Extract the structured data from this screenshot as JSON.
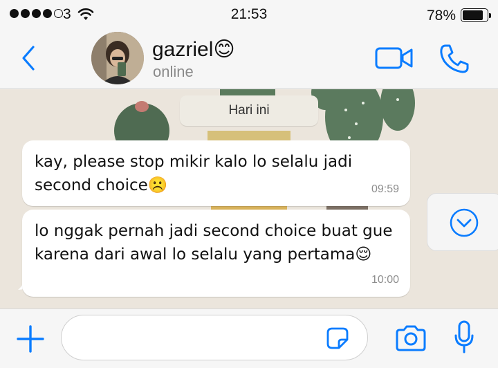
{
  "status_bar": {
    "carrier": "3",
    "time": "21:53",
    "battery_percent": "78%",
    "battery_level": 0.78,
    "signal_bars_filled": 4,
    "signal_bars_total": 5
  },
  "header": {
    "contact_name": "gazriel😊",
    "contact_status": "online"
  },
  "chat": {
    "date_label": "Hari ini",
    "messages": [
      {
        "text": "kay, please stop mikir kalo lo selalu jadi second choice☹️",
        "time": "09:59"
      },
      {
        "text": "lo nggak pernah jadi second choice buat gue karena dari awal lo selalu yang pertama😌",
        "time": "10:00"
      }
    ]
  },
  "composer": {
    "placeholder": "",
    "value": ""
  },
  "colors": {
    "accent": "#0a7cff",
    "bubble": "#ffffff",
    "background": "#f6f6f6"
  },
  "icons": [
    "back-chevron-icon",
    "video-camera-icon",
    "phone-icon",
    "chevron-down-icon",
    "plus-icon",
    "sticker-icon",
    "camera-icon",
    "microphone-icon",
    "wifi-icon",
    "battery-icon"
  ]
}
